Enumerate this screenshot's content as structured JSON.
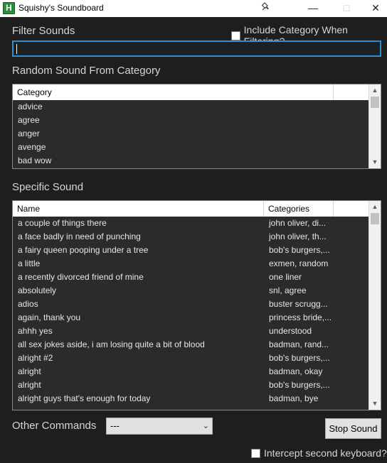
{
  "window": {
    "title": "Squishy's Soundboard",
    "icon_letter": "H",
    "icon_color": "#2e8b3e"
  },
  "filter": {
    "label": "Filter Sounds",
    "include_category_label": "Include Category When Filtering?",
    "include_category_checked": false,
    "value": ""
  },
  "random": {
    "label": "Random Sound From Category",
    "header": "Category",
    "items": [
      "advice",
      "agree",
      "anger",
      "avenge",
      "bad wow"
    ]
  },
  "specific": {
    "label": "Specific Sound",
    "headers": {
      "name": "Name",
      "categories": "Categories"
    },
    "rows": [
      {
        "name": "a couple of things there",
        "categories": "john oliver, di..."
      },
      {
        "name": "a face badly in need of punching",
        "categories": "john oliver, th..."
      },
      {
        "name": "a fairy queen pooping under a tree",
        "categories": "bob's burgers,..."
      },
      {
        "name": "a little",
        "categories": "exmen, random"
      },
      {
        "name": "a recently divorced friend of mine",
        "categories": "one liner"
      },
      {
        "name": "absolutely",
        "categories": "snl, agree"
      },
      {
        "name": "adios",
        "categories": "buster scrugg..."
      },
      {
        "name": "again, thank you",
        "categories": "princess bride,..."
      },
      {
        "name": "ahhh yes",
        "categories": "understood"
      },
      {
        "name": "all sex jokes aside, i am losing quite a bit of blood",
        "categories": "badman, rand..."
      },
      {
        "name": "alright #2",
        "categories": "bob's burgers,..."
      },
      {
        "name": "alright",
        "categories": "badman, okay"
      },
      {
        "name": "alright",
        "categories": "bob's burgers,..."
      },
      {
        "name": "alright guys that's enough for today",
        "categories": "badman, bye"
      }
    ]
  },
  "commands": {
    "label": "Other Commands",
    "selected": "---",
    "stop_label": "Stop Sound",
    "intercept_label": "Intercept second keyboard?",
    "intercept_checked": false
  },
  "icons": {
    "minimize": "minimize-icon",
    "maximize": "maximize-icon",
    "close": "close-icon",
    "pin": "pin-icon"
  },
  "colors": {
    "background": "#1e1e1e",
    "list_bg": "#2b2b2b",
    "focus_border": "#2d8ed8"
  }
}
